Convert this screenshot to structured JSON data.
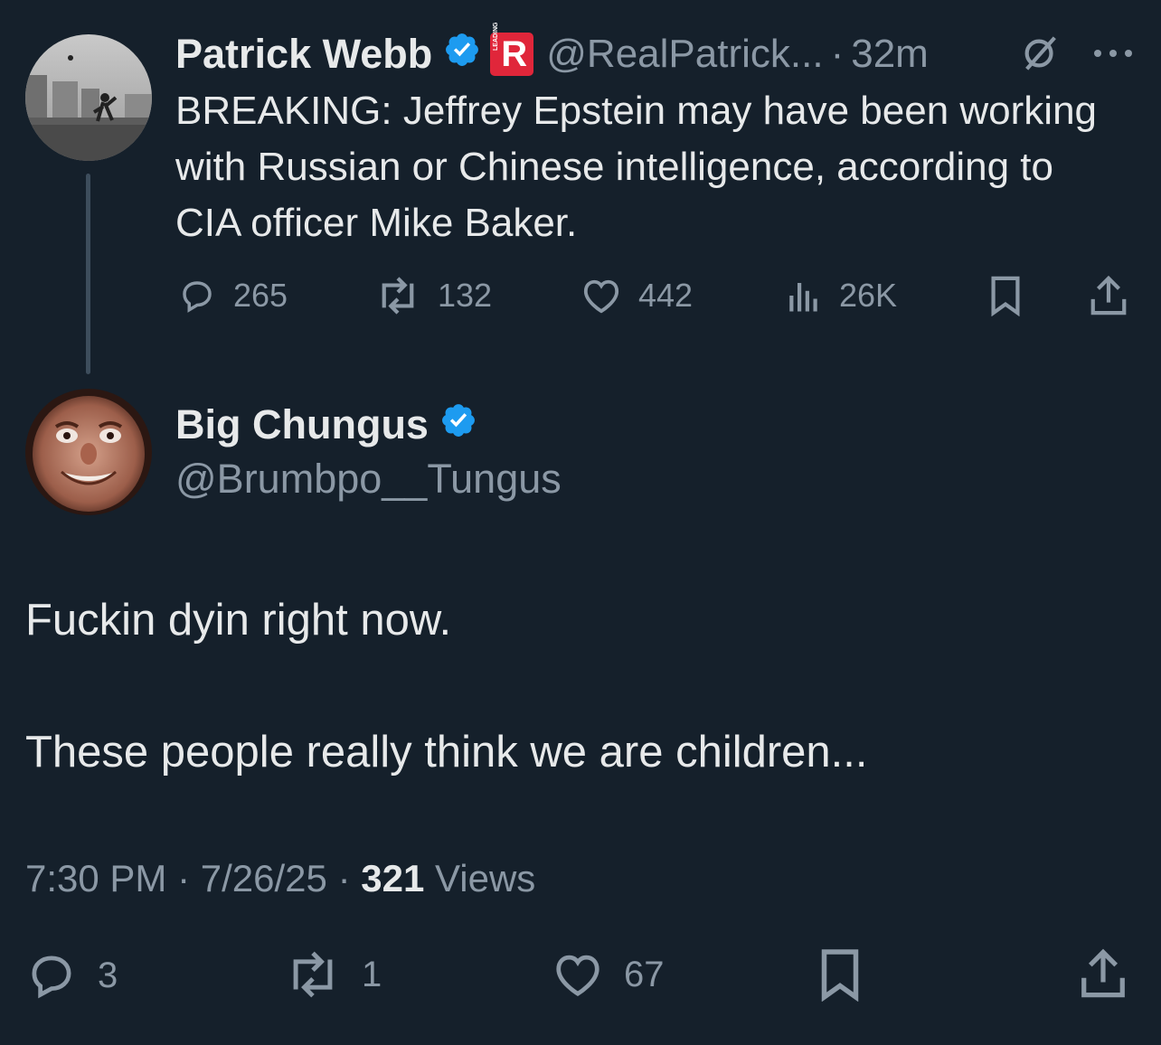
{
  "quoted_tweet": {
    "author_name": "Patrick Webb",
    "badge_text": "LEADING",
    "handle": "@RealPatrick...",
    "separator": "·",
    "time_ago": "32m",
    "text": "BREAKING: Jeffrey Epstein may have been working with Russian or Chinese intelligence, according to CIA officer Mike Baker.",
    "actions": {
      "replies": "265",
      "reposts": "132",
      "likes": "442",
      "views": "26K"
    }
  },
  "main_tweet": {
    "author_name": "Big Chungus",
    "handle": "@Brumbpo__Tungus",
    "paragraph_1": "Fuckin dyin right now.",
    "paragraph_2": "These people really think we are children...",
    "time": "7:30 PM",
    "date": "7/26/25",
    "separator": "·",
    "views_count": "321",
    "views_label": "Views",
    "actions": {
      "replies": "3",
      "reposts": "1",
      "likes": "67"
    }
  },
  "colors": {
    "background": "#15202b",
    "verified": "#1d9bf0",
    "text_primary": "#e7e9ea",
    "text_muted": "#8b98a5",
    "badge_red": "#e0263a"
  },
  "icons": [
    "verified-icon",
    "leading-badge-icon",
    "grok-icon",
    "more-icon",
    "reply-icon",
    "repost-icon",
    "like-icon",
    "views-icon",
    "bookmark-icon",
    "share-icon"
  ]
}
